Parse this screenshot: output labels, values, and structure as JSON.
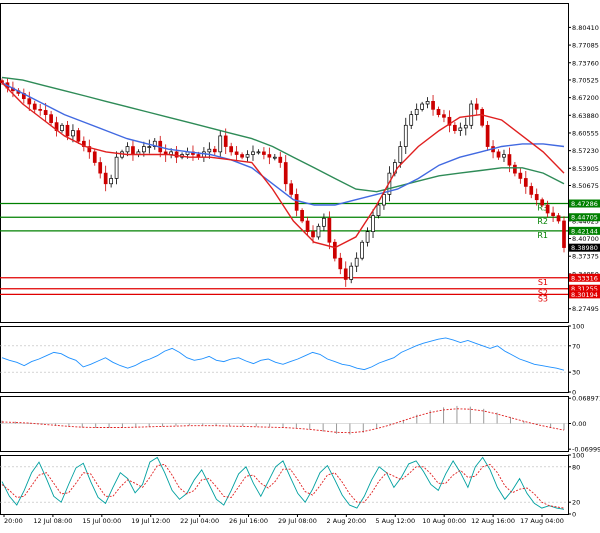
{
  "chart_data": [
    {
      "type": "candlestick",
      "title": "",
      "ylim": [
        8.25,
        8.85
      ],
      "y_ticks": [
        "8.80410",
        "8.77085",
        "8.73760",
        "8.70525",
        "8.67200",
        "8.63880",
        "8.60555",
        "8.57230",
        "8.53905",
        "8.50675",
        "8.47286",
        "8.44705",
        "8.44025",
        "8.42144",
        "8.40700",
        "8.38980",
        "8.37375",
        "8.34050",
        "8.33316",
        "8.31255",
        "8.30194",
        "8.27495"
      ],
      "tick_values": [
        8.8041,
        8.77085,
        8.7376,
        8.70525,
        8.672,
        8.6388,
        8.60555,
        8.5723,
        8.53905,
        8.50675,
        8.47286,
        8.44705,
        8.44025,
        8.42144,
        8.407,
        8.3898,
        8.37375,
        8.3405,
        8.33316,
        8.31255,
        8.30194,
        8.27495
      ],
      "x_tick_labels": [
        "20:00",
        "12 Jul 08:00",
        "15 Jul 00:00",
        "19 Jul 12:00",
        "22 Jul 04:00",
        "26 Jul 16:00",
        "29 Jul 08:00",
        "2 Aug 20:00",
        "5 Aug 12:00",
        "10 Aug 00:00",
        "12 Aug 16:00",
        "17 Aug 04:00"
      ],
      "current_price": "8.38980",
      "levels": [
        {
          "name": "R3",
          "value": 8.47286,
          "label": "8.47286",
          "color": "#008000"
        },
        {
          "name": "R2",
          "value": 8.44705,
          "label": "8.44705",
          "color": "#008000"
        },
        {
          "name": "R1",
          "value": 8.42144,
          "label": "8.42144",
          "color": "#008000"
        },
        {
          "name": "S1",
          "value": 8.33316,
          "label": "8.33316",
          "color": "#e00000"
        },
        {
          "name": "S2",
          "value": 8.31255,
          "label": "8.31255",
          "color": "#e00000"
        },
        {
          "name": "S3",
          "value": 8.30194,
          "label": "8.30194",
          "color": "#e00000"
        }
      ],
      "closes": [
        8.7,
        8.69,
        8.685,
        8.68,
        8.67,
        8.66,
        8.65,
        8.648,
        8.64,
        8.625,
        8.61,
        8.62,
        8.6,
        8.61,
        8.59,
        8.58,
        8.57,
        8.55,
        8.53,
        8.51,
        8.52,
        8.56,
        8.57,
        8.58,
        8.565,
        8.57,
        8.58,
        8.58,
        8.59,
        8.57,
        8.565,
        8.57,
        8.56,
        8.565,
        8.57,
        8.565,
        8.56,
        8.57,
        8.575,
        8.57,
        8.6,
        8.58,
        8.57,
        8.565,
        8.56,
        8.565,
        8.57,
        8.57,
        8.565,
        8.56,
        8.56,
        8.55,
        8.51,
        8.49,
        8.46,
        8.44,
        8.42,
        8.41,
        8.43,
        8.445,
        8.4,
        8.37,
        8.35,
        8.33,
        8.355,
        8.37,
        8.4,
        8.42,
        8.45,
        8.47,
        8.49,
        8.53,
        8.55,
        8.58,
        8.62,
        8.64,
        8.65,
        8.66,
        8.665,
        8.65,
        8.64,
        8.635,
        8.62,
        8.61,
        8.615,
        8.62,
        8.66,
        8.65,
        8.62,
        8.58,
        8.57,
        8.56,
        8.565,
        8.545,
        8.53,
        8.52,
        8.505,
        8.49,
        8.48,
        8.47,
        8.455,
        8.45,
        8.44,
        8.39
      ],
      "ma_red": [
        8.7,
        8.66,
        8.63,
        8.6,
        8.58,
        8.57,
        8.565,
        8.565,
        8.565,
        8.56,
        8.56,
        8.555,
        8.55,
        8.5,
        8.44,
        8.4,
        8.39,
        8.41,
        8.47,
        8.54,
        8.58,
        8.61,
        8.635,
        8.64,
        8.63,
        8.6,
        8.57,
        8.53
      ],
      "ma_blue": [
        8.7,
        8.68,
        8.66,
        8.64,
        8.625,
        8.61,
        8.595,
        8.585,
        8.575,
        8.57,
        8.565,
        8.555,
        8.54,
        8.51,
        8.48,
        8.47,
        8.47,
        8.48,
        8.49,
        8.5,
        8.52,
        8.545,
        8.56,
        8.57,
        8.58,
        8.585,
        8.585,
        8.58
      ],
      "ma_green": [
        8.71,
        8.705,
        8.695,
        8.685,
        8.675,
        8.665,
        8.655,
        8.645,
        8.635,
        8.625,
        8.615,
        8.605,
        8.595,
        8.58,
        8.56,
        8.54,
        8.52,
        8.5,
        8.495,
        8.505,
        8.515,
        8.525,
        8.53,
        8.535,
        8.54,
        8.54,
        8.53,
        8.51
      ]
    },
    {
      "type": "line",
      "name": "",
      "ylim": [
        0,
        100
      ],
      "y_ticks": [
        "100",
        "70",
        "30",
        "0"
      ],
      "tick_values": [
        100,
        70,
        30,
        0
      ],
      "values": [
        52,
        48,
        45,
        40,
        46,
        50,
        55,
        60,
        58,
        52,
        48,
        38,
        42,
        47,
        52,
        45,
        40,
        36,
        40,
        46,
        50,
        55,
        62,
        66,
        60,
        52,
        48,
        50,
        54,
        48,
        46,
        50,
        52,
        47,
        43,
        48,
        50,
        45,
        42,
        46,
        50,
        55,
        60,
        57,
        50,
        46,
        42,
        40,
        36,
        34,
        38,
        44,
        48,
        52,
        60,
        65,
        70,
        74,
        77,
        80,
        82,
        79,
        75,
        78,
        74,
        70,
        66,
        70,
        62,
        56,
        50,
        46,
        42,
        40,
        38,
        36,
        33
      ]
    },
    {
      "type": "bar",
      "ylim": [
        -0.075,
        0.075
      ],
      "y_ticks": [
        "0.068971",
        "0.00",
        "-0.069998"
      ],
      "tick_values": [
        0.068971,
        0,
        -0.069998
      ],
      "histogram": [
        0.008,
        0.005,
        0.002,
        -0.003,
        -0.006,
        -0.009,
        -0.011,
        -0.012,
        -0.012,
        -0.011,
        -0.01,
        -0.009,
        -0.008,
        -0.006,
        -0.005,
        -0.004,
        -0.005,
        -0.006,
        -0.007,
        -0.008,
        -0.009,
        -0.01,
        -0.012,
        -0.016,
        -0.022,
        -0.028,
        -0.03,
        -0.025,
        -0.015,
        -0.004,
        0.01,
        0.024,
        0.036,
        0.044,
        0.048,
        0.046,
        0.04,
        0.03,
        0.018,
        0.006,
        -0.004,
        -0.012,
        -0.018
      ],
      "signal": [
        0.004,
        0.003,
        0.001,
        -0.002,
        -0.005,
        -0.008,
        -0.01,
        -0.011,
        -0.011,
        -0.011,
        -0.01,
        -0.009,
        -0.008,
        -0.007,
        -0.006,
        -0.006,
        -0.006,
        -0.007,
        -0.008,
        -0.009,
        -0.01,
        -0.011,
        -0.013,
        -0.016,
        -0.02,
        -0.024,
        -0.025,
        -0.022,
        -0.014,
        -0.004,
        0.008,
        0.02,
        0.03,
        0.037,
        0.04,
        0.039,
        0.034,
        0.026,
        0.016,
        0.006,
        -0.003,
        -0.011,
        -0.018
      ]
    },
    {
      "type": "line",
      "ylim": [
        0,
        100
      ],
      "y_ticks": [
        "100",
        "80",
        "20",
        "0"
      ],
      "tick_values": [
        100,
        80,
        20,
        0
      ],
      "line_k": [
        55,
        30,
        15,
        40,
        70,
        88,
        60,
        30,
        20,
        50,
        78,
        86,
        55,
        28,
        18,
        45,
        70,
        60,
        36,
        50,
        88,
        96,
        70,
        40,
        25,
        35,
        58,
        75,
        50,
        25,
        15,
        40,
        68,
        80,
        52,
        30,
        55,
        80,
        90,
        62,
        35,
        20,
        42,
        70,
        82,
        58,
        32,
        15,
        10,
        30,
        58,
        80,
        70,
        45,
        62,
        85,
        90,
        72,
        50,
        40,
        68,
        90,
        70,
        45,
        80,
        96,
        75,
        45,
        25,
        40,
        60,
        35,
        18,
        10,
        14,
        10,
        8
      ],
      "line_d": [
        50,
        40,
        28,
        30,
        48,
        66,
        70,
        52,
        34,
        36,
        52,
        70,
        68,
        48,
        30,
        30,
        46,
        58,
        52,
        45,
        62,
        82,
        84,
        66,
        44,
        34,
        40,
        58,
        60,
        46,
        30,
        28,
        46,
        64,
        66,
        52,
        44,
        56,
        76,
        76,
        58,
        38,
        32,
        48,
        66,
        70,
        54,
        34,
        20,
        20,
        36,
        56,
        70,
        64,
        58,
        68,
        80,
        80,
        68,
        52,
        52,
        66,
        74,
        62,
        64,
        80,
        84,
        70,
        48,
        36,
        42,
        44,
        34,
        20,
        14,
        12,
        10
      ]
    }
  ],
  "colors": {
    "bull": "#000000",
    "bear": "#cc0000",
    "ma_red": "#e02020",
    "ma_blue": "#4169e1",
    "ma_green": "#2e8b57",
    "rsi": "#1e90ff",
    "macd_signal": "#e02020",
    "stoch_k": "#00a0a0",
    "stoch_d": "#e02020",
    "price_tag": "#000000"
  }
}
